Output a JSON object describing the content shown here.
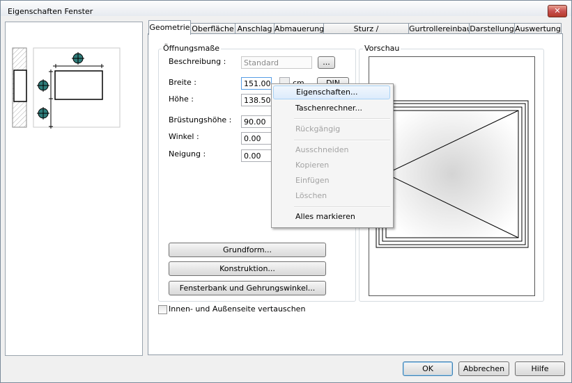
{
  "window": {
    "title": "Eigenschaften Fenster",
    "close_glyph": "✕"
  },
  "tabs": [
    {
      "label": "Geometrie"
    },
    {
      "label": "Oberfläche"
    },
    {
      "label": "Anschlag"
    },
    {
      "label": "Abmauerung"
    },
    {
      "label": "Sturz / Rolladenkasten"
    },
    {
      "label": "Gurtrollereinbau"
    },
    {
      "label": "Darstellung"
    },
    {
      "label": "Auswertung"
    }
  ],
  "geometry": {
    "group_title": "Öffnungsmaße",
    "beschreibung": {
      "label": "Beschreibung :",
      "value": "Standard",
      "browse_label": "..."
    },
    "breite": {
      "label": "Breite :",
      "value": "151.00",
      "unit": "cm",
      "din_label": "DIN"
    },
    "hoehe": {
      "label": "Höhe :",
      "value": "138.50"
    },
    "bruestungshoehe": {
      "label": "Brüstungshöhe :",
      "value": "90.00"
    },
    "winkel": {
      "label": "Winkel :",
      "value": "0.00"
    },
    "neigung": {
      "label": "Neigung :",
      "value": "0.00"
    }
  },
  "buttons": {
    "grundform": "Grundform...",
    "konstruktion": "Konstruktion...",
    "fensterbank": "Fensterbank und Gehrungswinkel..."
  },
  "preview": {
    "title": "Vorschau"
  },
  "swap_checkbox": {
    "label": "Innen- und Außenseite vertauschen",
    "checked": false
  },
  "footer": {
    "ok": "OK",
    "cancel": "Abbrechen",
    "help": "Hilfe"
  },
  "context_menu": {
    "items": [
      {
        "label": "Eigenschaften...",
        "enabled": true,
        "highlighted": true
      },
      {
        "label": "Taschenrechner...",
        "enabled": true
      },
      {
        "label": "Rückgängig",
        "enabled": false
      },
      {
        "label": "Ausschneiden",
        "enabled": false
      },
      {
        "label": "Kopieren",
        "enabled": false
      },
      {
        "label": "Einfügen",
        "enabled": false
      },
      {
        "label": "Löschen",
        "enabled": false
      },
      {
        "label": "Alles markieren",
        "enabled": true
      }
    ]
  },
  "colors": {
    "accent": "#3c7fb1",
    "marker_fill": "#2f7c7a",
    "menu_highlight": "#dcebfc"
  }
}
